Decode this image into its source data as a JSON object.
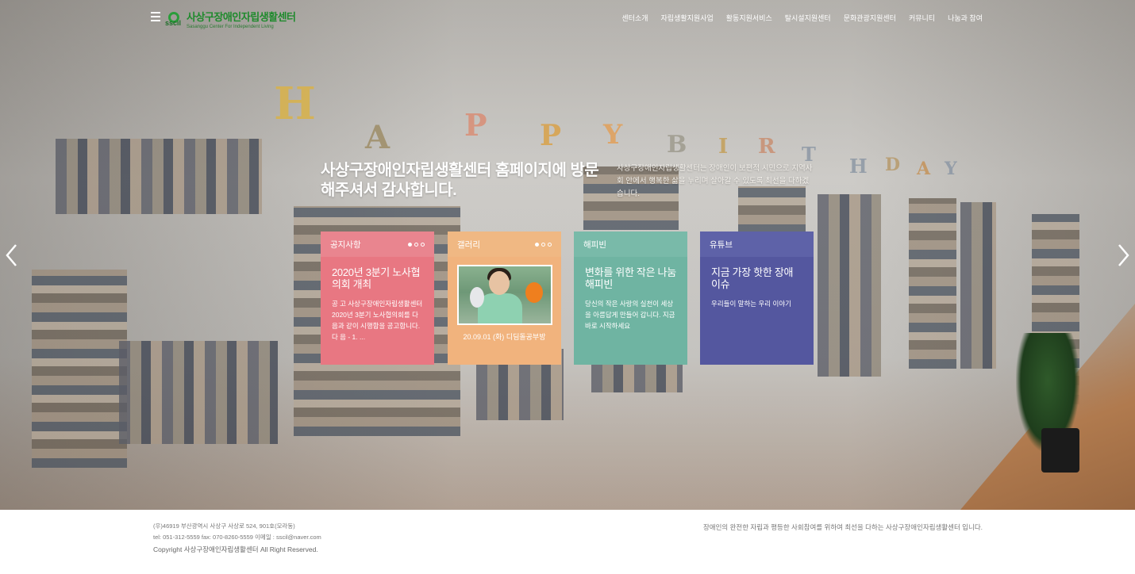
{
  "header": {
    "logo_title": "사상구장애인자립생활센터",
    "logo_sub": "Sasanggu Center For Independent Living",
    "logo_mark": "sscil",
    "nav": [
      "센터소개",
      "자립생활지원사업",
      "활동지원서비스",
      "탈시설지원센터",
      "문화관광지원센터",
      "커뮤니티",
      "나눔과 참여"
    ]
  },
  "hero": {
    "title": "사상구장애인자립생활센터 홈페이지에 방문해주셔서 감사합니다.",
    "description": "사상구장애인자립생활센터는 장애인이 보편적 시민으로 지역사회 안에서 행복한 삶을 누리며 살아갈 수 있도록 최선을 다하겠습니다.",
    "background_letters": [
      "H",
      "A",
      "P",
      "P",
      "Y",
      "B",
      "I",
      "R",
      "T",
      "H",
      "D",
      "A",
      "Y"
    ]
  },
  "cards": [
    {
      "label": "공지사항",
      "title": "2020년 3분기 노사협의회 개최",
      "text": "공 고 사상구장애인자립생활센터 2020년 3분기 노사협의회를 다음과 같이 시행함을 공고합니다. 다 음 - 1. ...",
      "color": "#e87782"
    },
    {
      "label": "갤러리",
      "caption": "20.09.01 (화) 디딤돌공부방",
      "color": "#f1b37d"
    },
    {
      "label": "해피빈",
      "title": "변화를 위한 작은 나눔 해피빈",
      "text": "당신의 작은 사랑의 실천이 세상을 아름답게 만들어 갑니다. 지금 바로 시작하세요",
      "color": "#6fb4a2"
    },
    {
      "label": "유튜브",
      "title": "지금 가장 핫한 장애 이슈",
      "text": "우리들이 말하는 우리 이야기",
      "color": "#54579f"
    }
  ],
  "footer": {
    "address": "(우)46919 부산광역시 사상구 사상로 524, 901호(모라동)",
    "contact": "tel: 051-312-5559  fax: 070-8260-5559  이메일 : sscil@naver.com",
    "copyright": "Copyright 사상구장애인자립생활센터 All Right Reserved.",
    "slogan": "장애인의 완전한 자립과 평등한 사회참여를 위하여 최선을 다하는 사상구장애인자립생활센터 입니다."
  }
}
